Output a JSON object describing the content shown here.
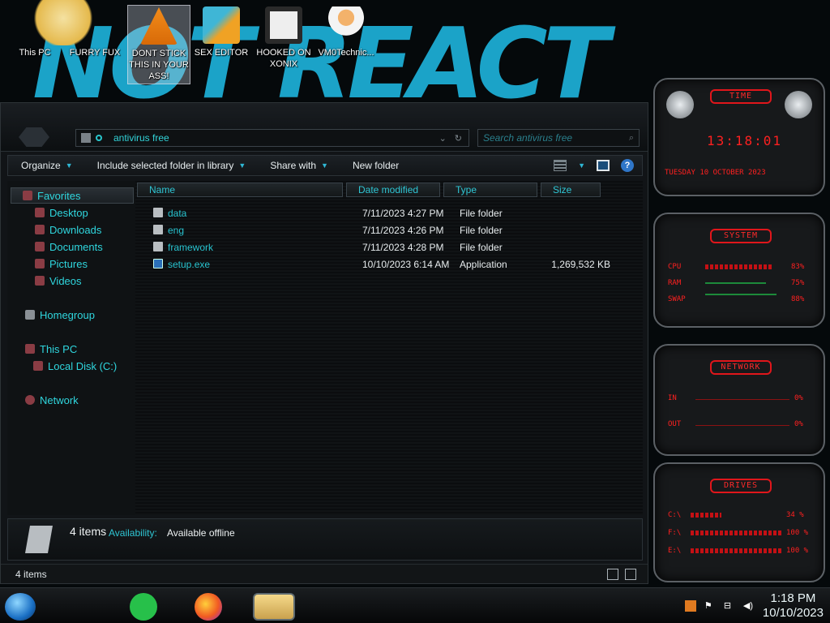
{
  "desktop": {
    "icons": [
      {
        "label": "This PC"
      },
      {
        "label": "FURRY FUX"
      },
      {
        "label": "DONT STICK THIS IN YOUR ASS!"
      },
      {
        "label": "SEX EDITOR"
      },
      {
        "label": "HOOKED ON XONIX"
      },
      {
        "label": "VM0Technic..."
      }
    ]
  },
  "explorer": {
    "address": "antivirus free",
    "search_placeholder": "Search antivirus free",
    "toolbar": {
      "organize": "Organize",
      "include_library": "Include selected folder in library",
      "share_with": "Share with",
      "new_folder": "New folder"
    },
    "nav": {
      "favorites": "Favorites",
      "desktop": "Desktop",
      "downloads": "Downloads",
      "documents": "Documents",
      "pictures": "Pictures",
      "videos": "Videos",
      "homegroup": "Homegroup",
      "this_pc": "This PC",
      "local_disk": "Local Disk (C:)",
      "network": "Network"
    },
    "columns": {
      "name": "Name",
      "date": "Date modified",
      "type": "Type",
      "size": "Size"
    },
    "files": [
      {
        "name": "data",
        "date": "7/11/2023 4:27 PM",
        "type": "File folder",
        "size": ""
      },
      {
        "name": "eng",
        "date": "7/11/2023 4:26 PM",
        "type": "File folder",
        "size": ""
      },
      {
        "name": "framework",
        "date": "7/11/2023 4:28 PM",
        "type": "File folder",
        "size": ""
      },
      {
        "name": "setup.exe",
        "date": "10/10/2023 6:14 AM",
        "type": "Application",
        "size": "1,269,532 KB"
      }
    ],
    "details": {
      "count": "4 items",
      "availability_label": "Availability:",
      "availability_value": "Available offline"
    },
    "status": "4 items"
  },
  "gadgets": {
    "time": {
      "title": "TIME",
      "clock": "13:18:01",
      "date": "TUESDAY 10 OCTOBER 2023"
    },
    "system": {
      "title": "SYSTEM",
      "cpu_label": "CPU",
      "cpu_val": "83%",
      "ram_label": "RAM",
      "ram_val": "75%",
      "swap_label": "SWAP",
      "swap_val": "88%",
      "cpu_pct": 83,
      "ram_pct": 75,
      "swap_pct": 88
    },
    "network": {
      "title": "NETWORK",
      "in_label": "IN",
      "in_val": "0%",
      "out_label": "OUT",
      "out_val": "0%"
    },
    "drives": {
      "title": "DRIVES",
      "drives": [
        {
          "label": "C:\\",
          "val": "34 %",
          "pct": 34
        },
        {
          "label": "F:\\",
          "val": "100 %",
          "pct": 100
        },
        {
          "label": "E:\\",
          "val": "100 %",
          "pct": 100
        }
      ]
    }
  },
  "taskbar": {
    "time": "1:18 PM",
    "date": "10/10/2023"
  },
  "colors": {
    "accent": "#2fd6de",
    "gadget_red": "#ff2020",
    "wallpaper_blue": "#1ba3c8"
  }
}
